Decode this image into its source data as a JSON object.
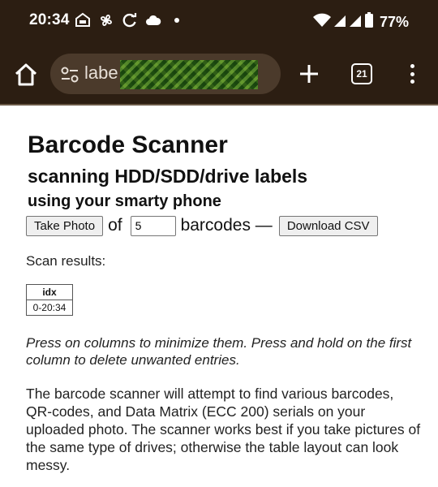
{
  "status_bar": {
    "time": "20:34",
    "battery": "77%",
    "icons": [
      "car-assist-icon",
      "pinwheel-icon",
      "sync-icon",
      "cloud-icon",
      "dot-icon",
      "wifi-icon",
      "signal-icon",
      "signal-icon",
      "battery-icon"
    ]
  },
  "browser": {
    "url_text": "labe",
    "tab_count": "21",
    "colors": {
      "bar": "#2c1e12",
      "omnibox": "#4b3a2b"
    }
  },
  "page": {
    "title": "Barcode Scanner",
    "subtitle": "scanning HDD/SDD/drive labels",
    "subtitle2": "using your smarty phone",
    "take_photo_label": "Take Photo",
    "of_text": "of",
    "barcode_count": "5",
    "barcodes_text": "barcodes —",
    "download_csv_label": "Download CSV",
    "scan_results_label": "Scan results:",
    "table": {
      "headers": [
        "idx"
      ],
      "rows": [
        [
          "0-20:34"
        ]
      ]
    },
    "note": "Press on columns to minimize them. Press and hold on the first column to delete unwanted entries.",
    "description": "The barcode scanner will attempt to find various barcodes, QR-codes, and Data Matrix (ECC 200) serials on your uploaded photo. The scanner works best if you take pictures of the same type of drives; otherwise the table layout can look messy."
  }
}
